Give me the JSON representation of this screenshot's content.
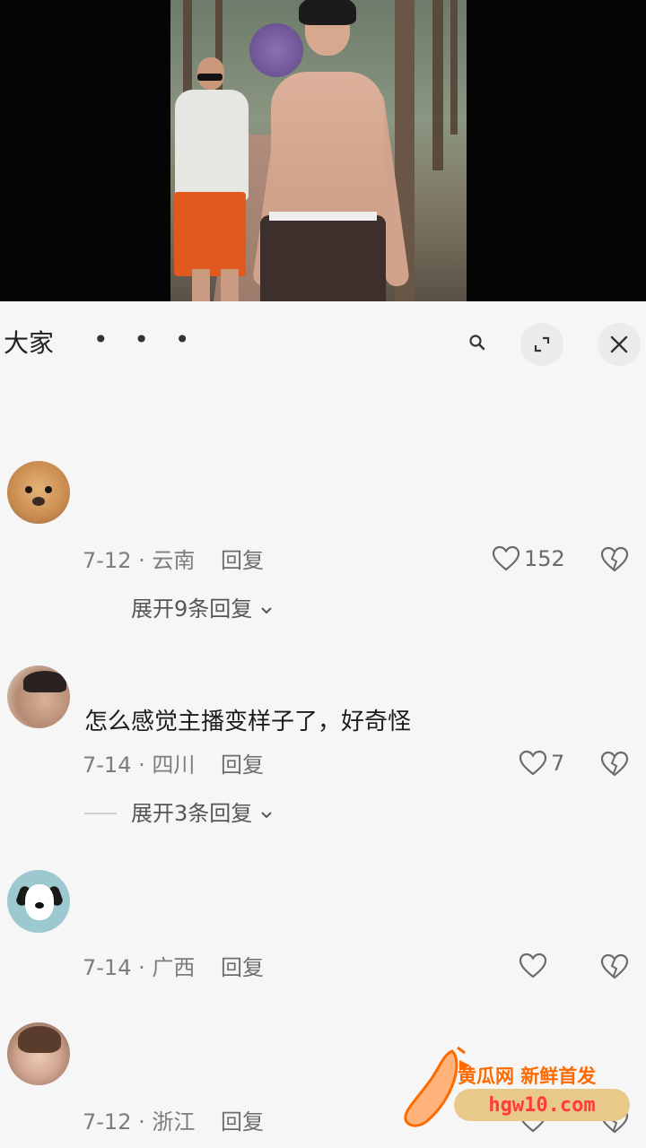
{
  "header": {
    "title": "大家",
    "more_dots": "• • •"
  },
  "comments": [
    {
      "text": "",
      "date": "7-12 · 云南",
      "reply_label": "回复",
      "likes": "152",
      "expand_label": "展开9条回复"
    },
    {
      "text": "怎么感觉主播变样子了，好奇怪",
      "date": "7-14 · 四川",
      "reply_label": "回复",
      "likes": "7",
      "expand_label": "展开3条回复"
    },
    {
      "text": "",
      "date": "7-14 · 广西",
      "reply_label": "回复",
      "likes": ""
    },
    {
      "text": "",
      "date": "7-12 · 浙江",
      "reply_label": "回复",
      "likes": ""
    }
  ],
  "watermark": {
    "line1": "黄瓜网 新鲜首发",
    "line2": "hgw10.com"
  },
  "colors": {
    "panel_bg": "#f6f6f6",
    "video_bg": "#050505",
    "watermark_orange": "#ff6a00"
  }
}
